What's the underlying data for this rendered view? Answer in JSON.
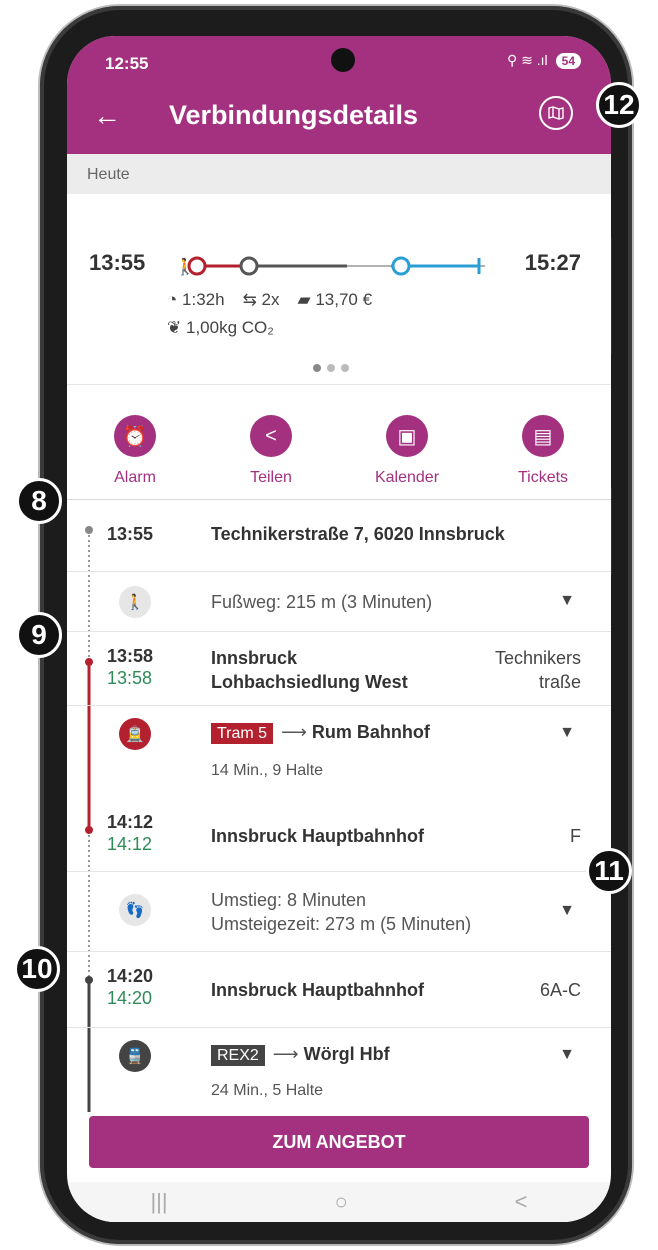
{
  "status": {
    "time": "12:55",
    "battery": "54",
    "signal": "⚲ ≋ .ıl"
  },
  "appbar": {
    "back": "←",
    "title": "Verbindungsdetails",
    "map_icon": "map-icon"
  },
  "callouts": {
    "b8": "8",
    "b9": "9",
    "b10": "10",
    "b11": "11",
    "b12": "12"
  },
  "day_label": "Heute",
  "summary": {
    "departure": "13:55",
    "arrival": "15:27",
    "duration": "1:32h",
    "transfers": "2x",
    "price": "13,70 €",
    "co2": "1,00kg CO₂",
    "duration_icon": "◔",
    "transfer_icon": "⇆",
    "price_icon": "▰",
    "co2_icon": "❦",
    "colors": {
      "tram": "#b3202e",
      "bus": "#555555",
      "train": "#2a9fd6"
    }
  },
  "actions": [
    {
      "label": "Alarm",
      "icon": "⏰"
    },
    {
      "label": "Teilen",
      "icon": "<"
    },
    {
      "label": "Kalender",
      "icon": "▣"
    },
    {
      "label": "Tickets",
      "icon": "▤"
    }
  ],
  "journey": {
    "stop1": {
      "time": "13:55",
      "name": "Technikerstraße 7, 6020 Innsbruck"
    },
    "walk": {
      "icon": "🚶",
      "text": "Fußweg: 215 m (3 Minuten)"
    },
    "stop2": {
      "time": "13:58",
      "rt": "13:58",
      "name1": "Innsbruck",
      "name2": "Lohbachsiedlung West",
      "plat1": "Technikers",
      "plat2": "traße"
    },
    "tram": {
      "icon": "🚊",
      "line": "Tram 5",
      "arrow": "⟶",
      "dest": "Rum Bahnhof",
      "info": "14 Min., 9 Halte",
      "color": "#b3202e"
    },
    "stop3": {
      "time": "14:12",
      "rt": "14:12",
      "name": "Innsbruck Hauptbahnhof",
      "plat": "F"
    },
    "transfer": {
      "icon": "👣",
      "line1": "Umstieg: 8 Minuten",
      "line2": "Umsteigezeit: 273 m (5 Minuten)"
    },
    "stop4": {
      "time": "14:20",
      "rt": "14:20",
      "name": "Innsbruck Hauptbahnhof",
      "plat": "6A-C"
    },
    "train": {
      "icon": "🚆",
      "line": "REX2",
      "arrow": "⟶",
      "dest": "Wörgl Hbf",
      "info": "24 Min., 5 Halte",
      "color": "#444444"
    },
    "chevron": "▼"
  },
  "cta": "ZUM ANGEBOT",
  "navbar": {
    "recents": "|||",
    "home": "○",
    "back": "<"
  }
}
